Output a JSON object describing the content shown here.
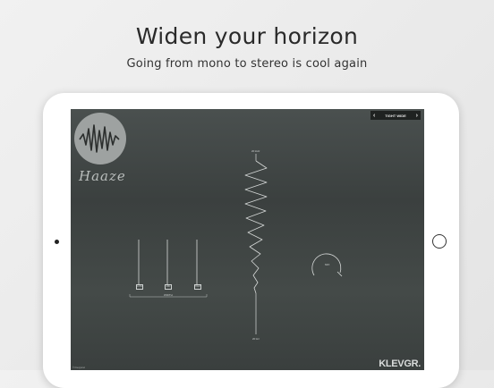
{
  "promo": {
    "headline": "Widen your horizon",
    "subline": "Going from mono to stereo is cool again"
  },
  "app": {
    "logo_text": "Haaze",
    "preset": {
      "name": "TIGHT WIDE",
      "prev": "‹",
      "next": "›"
    },
    "sliders": [
      {
        "label": "LOW"
      },
      {
        "label": "MID"
      },
      {
        "label": "HIGH"
      }
    ],
    "slider_group_label": "WIDTH",
    "spring_top_label": "20 kHz",
    "spring_bottom_label": "20 Hz",
    "knob_label": "MIX",
    "brand": "KLEVGR.",
    "copyright": "© Klevgrand"
  }
}
